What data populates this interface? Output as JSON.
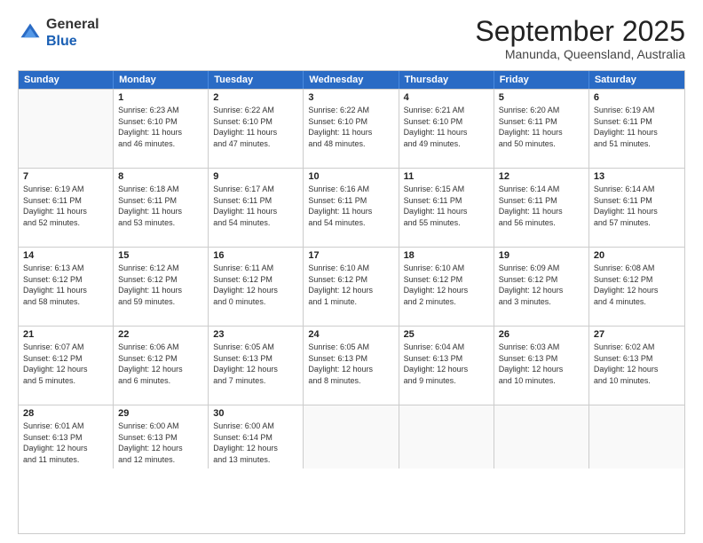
{
  "logo": {
    "general": "General",
    "blue": "Blue"
  },
  "title": "September 2025",
  "location": "Manunda, Queensland, Australia",
  "days_of_week": [
    "Sunday",
    "Monday",
    "Tuesday",
    "Wednesday",
    "Thursday",
    "Friday",
    "Saturday"
  ],
  "weeks": [
    [
      {
        "day": "",
        "info": ""
      },
      {
        "day": "1",
        "info": "Sunrise: 6:23 AM\nSunset: 6:10 PM\nDaylight: 11 hours\nand 46 minutes."
      },
      {
        "day": "2",
        "info": "Sunrise: 6:22 AM\nSunset: 6:10 PM\nDaylight: 11 hours\nand 47 minutes."
      },
      {
        "day": "3",
        "info": "Sunrise: 6:22 AM\nSunset: 6:10 PM\nDaylight: 11 hours\nand 48 minutes."
      },
      {
        "day": "4",
        "info": "Sunrise: 6:21 AM\nSunset: 6:10 PM\nDaylight: 11 hours\nand 49 minutes."
      },
      {
        "day": "5",
        "info": "Sunrise: 6:20 AM\nSunset: 6:11 PM\nDaylight: 11 hours\nand 50 minutes."
      },
      {
        "day": "6",
        "info": "Sunrise: 6:19 AM\nSunset: 6:11 PM\nDaylight: 11 hours\nand 51 minutes."
      }
    ],
    [
      {
        "day": "7",
        "info": "Sunrise: 6:19 AM\nSunset: 6:11 PM\nDaylight: 11 hours\nand 52 minutes."
      },
      {
        "day": "8",
        "info": "Sunrise: 6:18 AM\nSunset: 6:11 PM\nDaylight: 11 hours\nand 53 minutes."
      },
      {
        "day": "9",
        "info": "Sunrise: 6:17 AM\nSunset: 6:11 PM\nDaylight: 11 hours\nand 54 minutes."
      },
      {
        "day": "10",
        "info": "Sunrise: 6:16 AM\nSunset: 6:11 PM\nDaylight: 11 hours\nand 54 minutes."
      },
      {
        "day": "11",
        "info": "Sunrise: 6:15 AM\nSunset: 6:11 PM\nDaylight: 11 hours\nand 55 minutes."
      },
      {
        "day": "12",
        "info": "Sunrise: 6:14 AM\nSunset: 6:11 PM\nDaylight: 11 hours\nand 56 minutes."
      },
      {
        "day": "13",
        "info": "Sunrise: 6:14 AM\nSunset: 6:11 PM\nDaylight: 11 hours\nand 57 minutes."
      }
    ],
    [
      {
        "day": "14",
        "info": "Sunrise: 6:13 AM\nSunset: 6:12 PM\nDaylight: 11 hours\nand 58 minutes."
      },
      {
        "day": "15",
        "info": "Sunrise: 6:12 AM\nSunset: 6:12 PM\nDaylight: 11 hours\nand 59 minutes."
      },
      {
        "day": "16",
        "info": "Sunrise: 6:11 AM\nSunset: 6:12 PM\nDaylight: 12 hours\nand 0 minutes."
      },
      {
        "day": "17",
        "info": "Sunrise: 6:10 AM\nSunset: 6:12 PM\nDaylight: 12 hours\nand 1 minute."
      },
      {
        "day": "18",
        "info": "Sunrise: 6:10 AM\nSunset: 6:12 PM\nDaylight: 12 hours\nand 2 minutes."
      },
      {
        "day": "19",
        "info": "Sunrise: 6:09 AM\nSunset: 6:12 PM\nDaylight: 12 hours\nand 3 minutes."
      },
      {
        "day": "20",
        "info": "Sunrise: 6:08 AM\nSunset: 6:12 PM\nDaylight: 12 hours\nand 4 minutes."
      }
    ],
    [
      {
        "day": "21",
        "info": "Sunrise: 6:07 AM\nSunset: 6:12 PM\nDaylight: 12 hours\nand 5 minutes."
      },
      {
        "day": "22",
        "info": "Sunrise: 6:06 AM\nSunset: 6:12 PM\nDaylight: 12 hours\nand 6 minutes."
      },
      {
        "day": "23",
        "info": "Sunrise: 6:05 AM\nSunset: 6:13 PM\nDaylight: 12 hours\nand 7 minutes."
      },
      {
        "day": "24",
        "info": "Sunrise: 6:05 AM\nSunset: 6:13 PM\nDaylight: 12 hours\nand 8 minutes."
      },
      {
        "day": "25",
        "info": "Sunrise: 6:04 AM\nSunset: 6:13 PM\nDaylight: 12 hours\nand 9 minutes."
      },
      {
        "day": "26",
        "info": "Sunrise: 6:03 AM\nSunset: 6:13 PM\nDaylight: 12 hours\nand 10 minutes."
      },
      {
        "day": "27",
        "info": "Sunrise: 6:02 AM\nSunset: 6:13 PM\nDaylight: 12 hours\nand 10 minutes."
      }
    ],
    [
      {
        "day": "28",
        "info": "Sunrise: 6:01 AM\nSunset: 6:13 PM\nDaylight: 12 hours\nand 11 minutes."
      },
      {
        "day": "29",
        "info": "Sunrise: 6:00 AM\nSunset: 6:13 PM\nDaylight: 12 hours\nand 12 minutes."
      },
      {
        "day": "30",
        "info": "Sunrise: 6:00 AM\nSunset: 6:14 PM\nDaylight: 12 hours\nand 13 minutes."
      },
      {
        "day": "",
        "info": ""
      },
      {
        "day": "",
        "info": ""
      },
      {
        "day": "",
        "info": ""
      },
      {
        "day": "",
        "info": ""
      }
    ]
  ]
}
